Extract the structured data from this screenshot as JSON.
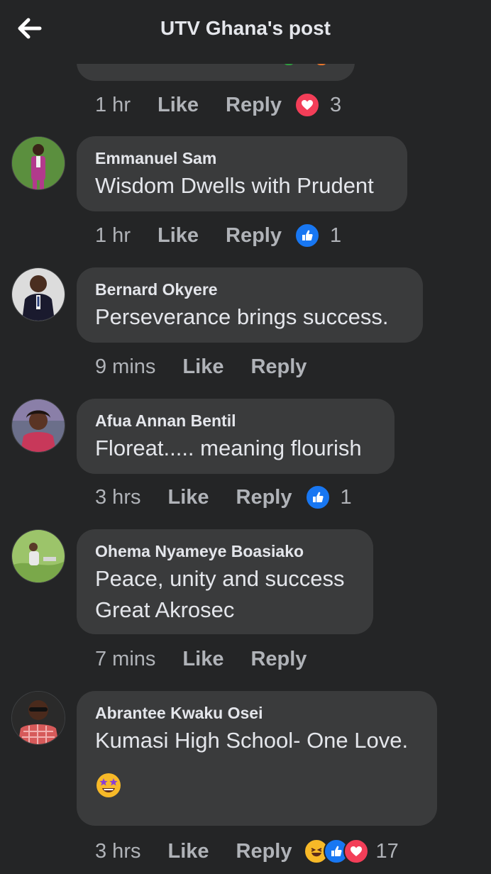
{
  "header": {
    "title": "UTV Ghana's post",
    "back_icon": "arrow-left-icon"
  },
  "actions": {
    "like": "Like",
    "reply": "Reply"
  },
  "previous_comment": {
    "time": "1 hr",
    "reactions": [
      "heart-icon"
    ],
    "reaction_count": "3"
  },
  "comments": [
    {
      "author": "Emmanuel Sam",
      "text": "Wisdom Dwells with Prudent",
      "time": "1 hr",
      "reactions": [
        "like-icon"
      ],
      "reaction_count": "1"
    },
    {
      "author": "Bernard Okyere",
      "text": "Perseverance brings success.",
      "time": "9 mins",
      "reactions": [],
      "reaction_count": ""
    },
    {
      "author": "Afua Annan Bentil",
      "text": "Floreat..... meaning flourish",
      "time": "3 hrs",
      "reactions": [
        "like-icon"
      ],
      "reaction_count": "1"
    },
    {
      "author": "Ohema Nyameye Boasiako",
      "text_line1": "Peace, unity and success",
      "text_line2": "Great Akrosec",
      "time": "7 mins",
      "reactions": [],
      "reaction_count": ""
    },
    {
      "author": "Abrantee Kwaku Osei",
      "text": "Kumasi High School- One Love.",
      "emoji": "star-struck-emoji",
      "time": "3 hrs",
      "reactions": [
        "haha-icon",
        "like-icon",
        "heart-icon"
      ],
      "reaction_count": "17"
    }
  ],
  "colors": {
    "background": "#242526",
    "bubble": "#3a3b3c",
    "text": "#e4e6eb",
    "secondary_text": "#b0b3b8",
    "like_blue": "#1877f2",
    "heart_red": "#f33e58",
    "haha_yellow": "#f7b928"
  }
}
